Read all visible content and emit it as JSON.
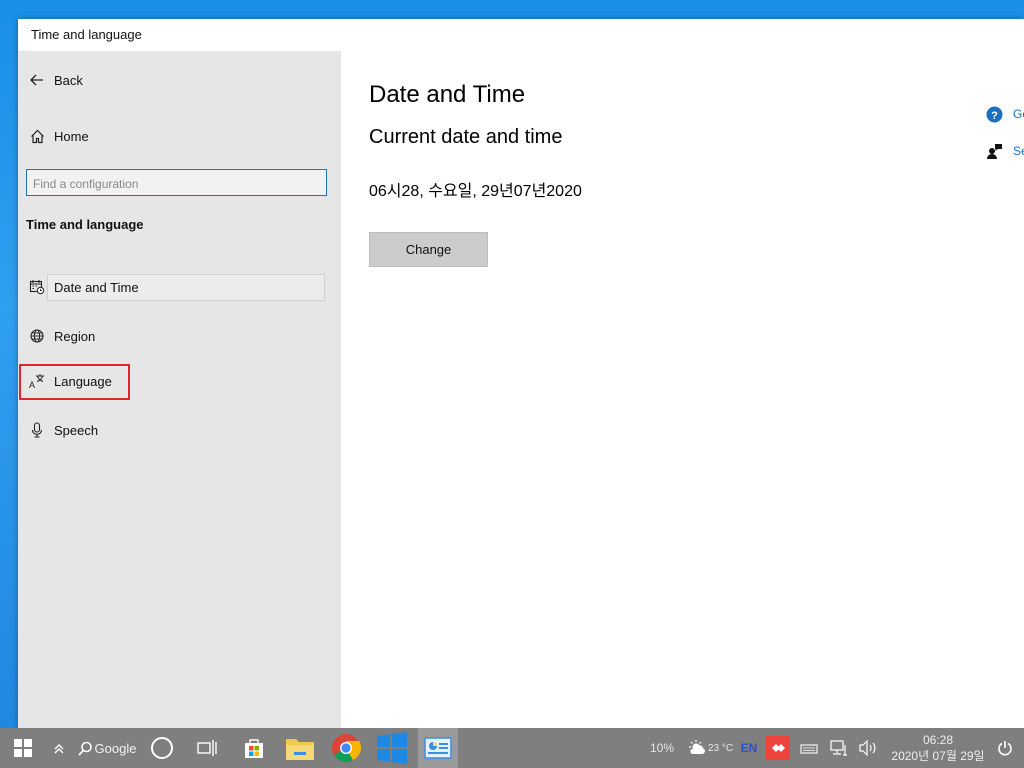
{
  "window": {
    "title": "Time and language"
  },
  "sidebar": {
    "back_label": "Back",
    "home_label": "Home",
    "search_placeholder": "Find a configuration",
    "section_title": "Time and language",
    "items": [
      {
        "label": "Date and Time",
        "icon": "calendar-clock-icon"
      },
      {
        "label": "Region",
        "icon": "globe-icon"
      },
      {
        "label": "Language",
        "icon": "language-icon"
      },
      {
        "label": "Speech",
        "icon": "microphone-icon"
      }
    ]
  },
  "main": {
    "title": "Date and Time",
    "subtitle": "Current date and time",
    "current_datetime": "06시28, 수요일, 29년07년2020",
    "change_button": "Change",
    "right_links": [
      {
        "label": "Ge",
        "icon": "help-circle-icon"
      },
      {
        "label": "Se",
        "icon": "feedback-person-icon"
      }
    ]
  },
  "taskbar": {
    "search_label": "Google",
    "battery": "10%",
    "weather": "23 °C",
    "language": "EN",
    "time": "06:28",
    "date": "2020년 07월 29일"
  },
  "colors": {
    "accent": "#1e73be",
    "highlight": "#e0262b",
    "taskbar": "#7f7f7f",
    "link": "#1a6fc2"
  }
}
